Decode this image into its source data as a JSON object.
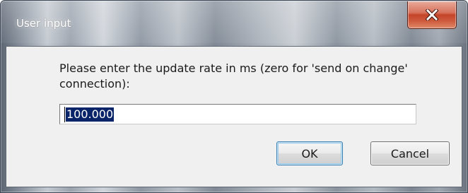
{
  "dialog": {
    "title": "User input",
    "prompt": "Please enter the update rate in ms (zero for 'send on change' connection):",
    "input_value": "100.000",
    "ok_label": "OK",
    "cancel_label": "Cancel",
    "close_icon": "close-icon"
  },
  "colors": {
    "close_button": "#c4442a",
    "selection_highlight": "#0a246a",
    "client_background": "#f0f0f0"
  }
}
